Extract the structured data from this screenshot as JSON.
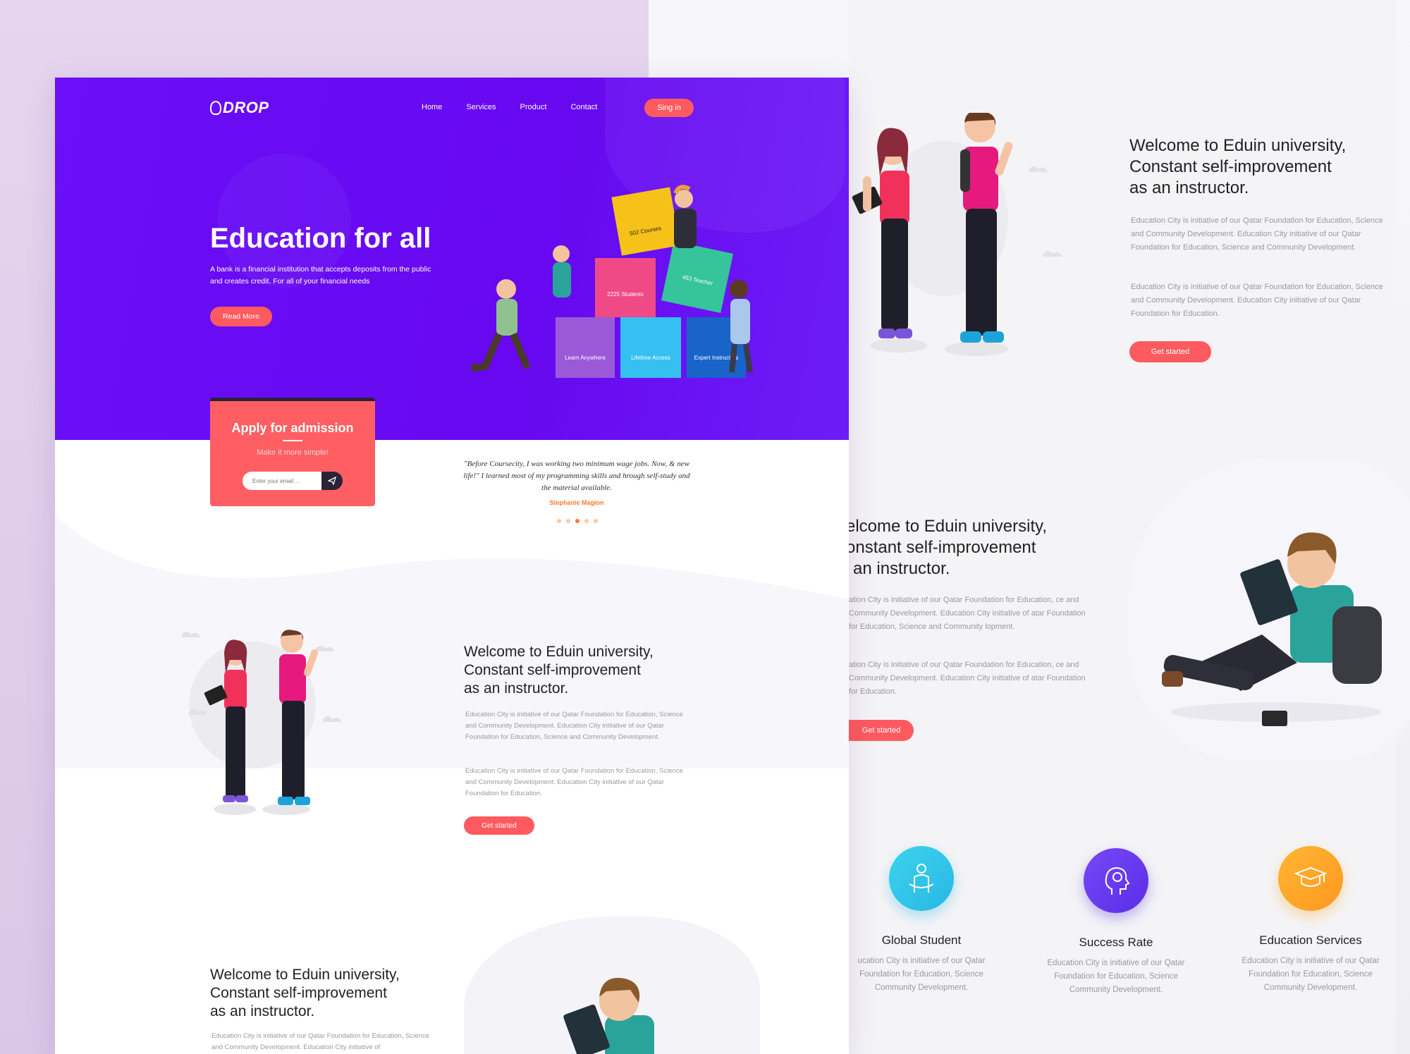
{
  "brand": {
    "logo_text": "DROP"
  },
  "nav": {
    "items": [
      "Home",
      "Services",
      "Product",
      "Contact"
    ],
    "signin_label": "Sing in"
  },
  "hero": {
    "title": "Education for all",
    "description": "A bank is a financial institution that accepts deposits from the public and creates credit. For all of your financial needs",
    "read_more_label": "Read More",
    "blocks": {
      "courses": "502 Courses",
      "students": "2225 Students",
      "teacher": "453 Teacher",
      "learn": "Learn Anywhere",
      "lifetime": "Lifetime Access",
      "expert": "Expert Instructors"
    }
  },
  "admission": {
    "title": "Apply for admission",
    "subtitle": "Make it more simple!",
    "email_placeholder": "Enter your email ..."
  },
  "testimonial": {
    "quote": "\"Before Coursecity, I was working two minimum wage jobs. Now, & new life!\" I learned most of my programming skills and hrough self-study and the material available.",
    "author": "Stephanie Magion",
    "dots": 5,
    "active_dot": 2
  },
  "section": {
    "title_line1": "Welcome to Eduin university,",
    "title_line2": "Constant self-improvement",
    "title_line3": "as an instructor.",
    "para1": "Education City is initiative of our Qatar Foundation for Education, Science and Community Development. Education City initiative of our Qatar Foundation for Education, Science and Community Development.",
    "para2": "Education City is initiative of our Qatar Foundation for Education, Science and Community Development. Education City initiative of our Qatar Foundation for Education.",
    "button_label": "Get started"
  },
  "right_section2": {
    "title_line1": "elcome to Eduin university,",
    "title_line2": "onstant self-improvement",
    "title_line3": "an instructor.",
    "para1": "ation City is initiative of our Qatar Foundation for Education, ce and Community Development. Education City initiative of atar Foundation for Education, Science and Community lopment.",
    "para2": "ation City is initiative of our Qatar Foundation for Education, ce and Community Development. Education City initiative of atar Foundation for Education.",
    "button_label": "Get started"
  },
  "features": [
    {
      "name": "Global Student",
      "desc": "ucation City is initiative of our Qatar Foundation for Education, Science Community Development.",
      "color": "#2ec4e8",
      "icon": "student-icon"
    },
    {
      "name": "Success Rate",
      "desc": "Education City is initiative of our Qatar Foundation for Education, Science Community Development.",
      "color": "#6a3cf0",
      "icon": "lightbulb-head-icon"
    },
    {
      "name": "Education Services",
      "desc": "Education City is initiative of our Qatar Foundation for Education, Science Community Development.",
      "color": "#ffa321",
      "icon": "graduation-cap-icon"
    }
  ],
  "bottom_section": {
    "title_line1": "Welcome to Eduin university,",
    "title_line2": "Constant self-improvement",
    "title_line3": "as an instructor.",
    "para": "Education City is initiative of our Qatar Foundation for Education, Science and Community Development. Education City initiative of"
  },
  "colors": {
    "hero": "#6a0ff8",
    "accent": "#ff5a5f",
    "dark": "#2b2238"
  }
}
